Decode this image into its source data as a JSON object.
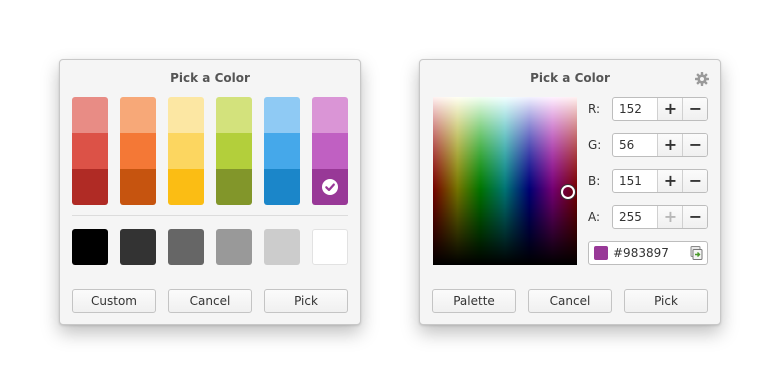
{
  "left_dialog": {
    "title": "Pick a Color",
    "palette": [
      {
        "colors": [
          "#e88c85",
          "#dc5247",
          "#b02b25"
        ]
      },
      {
        "colors": [
          "#f7a878",
          "#f47836",
          "#c6540f"
        ]
      },
      {
        "colors": [
          "#fce7a3",
          "#fcd660",
          "#fbbd14"
        ]
      },
      {
        "colors": [
          "#d3e27c",
          "#b3cf3b",
          "#82962a"
        ]
      },
      {
        "colors": [
          "#8fcaf4",
          "#45a8ea",
          "#1b86c9"
        ]
      },
      {
        "colors": [
          "#da95d6",
          "#c060c2",
          "#983897"
        ]
      }
    ],
    "selected_swatch": "#983897",
    "grays": [
      "#000000",
      "#333333",
      "#666666",
      "#999999",
      "#cccccc",
      "#ffffff"
    ],
    "buttons": {
      "custom": "Custom",
      "cancel": "Cancel",
      "pick": "Pick"
    }
  },
  "right_dialog": {
    "title": "Pick a Color",
    "settings_icon": "gear-icon",
    "channels": [
      {
        "label": "R:",
        "value": "152",
        "plus_enabled": true
      },
      {
        "label": "G:",
        "value": "56",
        "plus_enabled": true
      },
      {
        "label": "B:",
        "value": "151",
        "plus_enabled": true
      },
      {
        "label": "A:",
        "value": "255",
        "plus_enabled": false
      }
    ],
    "plus_glyph": "+",
    "minus_glyph": "−",
    "hex": {
      "value": "#983897",
      "swatch": "#983897",
      "copy_icon": "copy-icon"
    },
    "buttons": {
      "palette": "Palette",
      "cancel": "Cancel",
      "pick": "Pick"
    }
  }
}
